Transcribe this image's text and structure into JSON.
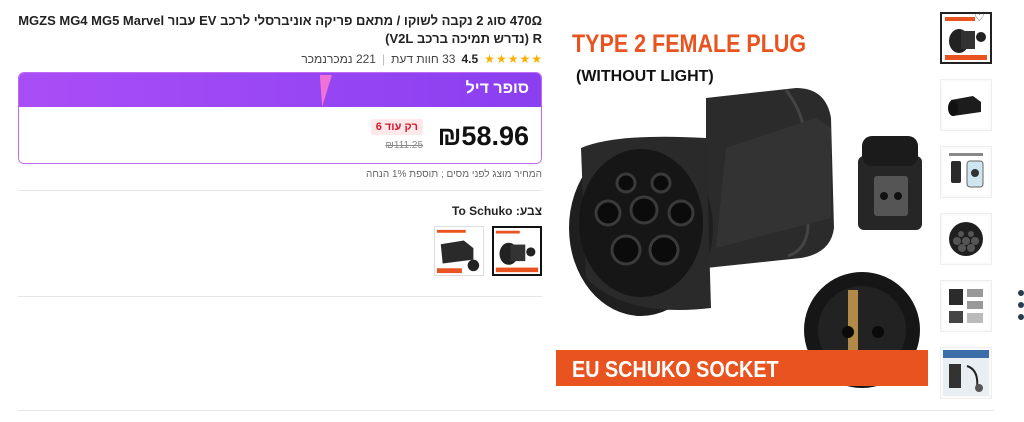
{
  "product": {
    "title": "470Ω סוג 2 נקבה לשוקו / מתאם פריקה אוניברסלי לרכב EV עבור MGZS MG4 MG5 Marvel R (נדרש תמיכה ברכב V2L)",
    "rating": "4.5",
    "reviews": "33 חוות דעת",
    "sold": "221 נמכרנמכר",
    "stars_count": 4.5
  },
  "deal": {
    "label": "סופר דיל",
    "price": "₪58.96",
    "left_badge": "רק עוד 6",
    "old_price": "₪111.25",
    "note": "המחיר מוצג לפני מסים ; תוספת 1% הנחה"
  },
  "color": {
    "label": "צבע: To Schuko",
    "options": [
      "To Schuko",
      "To Schuko (variant)"
    ],
    "selected_index": 0
  },
  "main_image": {
    "heading": "TYPE 2 FEMALE PLUG",
    "subheading": "(WITHOUT LIGHT)",
    "banner": "EU SCHUKO SOCKET"
  },
  "thumbnails": [
    {
      "name": "thumb-1",
      "active": true
    },
    {
      "name": "thumb-2",
      "active": false
    },
    {
      "name": "thumb-3",
      "active": false
    },
    {
      "name": "thumb-4",
      "active": false
    },
    {
      "name": "thumb-5",
      "active": false
    },
    {
      "name": "thumb-6",
      "active": false
    }
  ],
  "colors": {
    "accent_purple": "#9a45f3",
    "brand_orange": "#e8531f",
    "star": "#fbb000",
    "badge_red": "#d4182c"
  },
  "icons": {
    "favorite": "heart-icon",
    "star": "star-icon",
    "more": "more-dots-icon"
  }
}
